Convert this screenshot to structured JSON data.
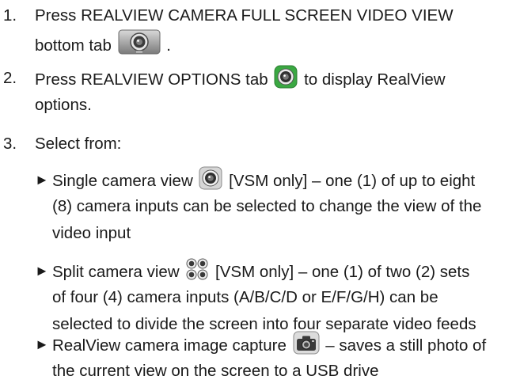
{
  "steps": [
    {
      "number": "1.",
      "line1": "Press REALVIEW CAMERA FULL SCREEN VIDEO VIEW",
      "line2_before": "bottom tab",
      "line2_after": ".",
      "icon": "camera-lens-tab-icon"
    },
    {
      "number": "2.",
      "line1_before": "Press REALVIEW OPTIONS tab",
      "line1_after": "to display RealView",
      "line2": "options.",
      "icon": "green-camera-lens-icon"
    },
    {
      "number": "3.",
      "line1": "Select from:"
    }
  ],
  "options": [
    {
      "bullet": "►",
      "line1_before": "Single camera view",
      "line1_after": "[VSM only] – one (1) of up to eight",
      "line2": "(8) camera inputs can be selected to change the view of the",
      "line3": "video input",
      "icon": "single-camera-lens-icon"
    },
    {
      "bullet": "►",
      "line1_before": "Split camera view",
      "line1_after": "[VSM only] – one (1) of two (2) sets",
      "line2": "of four (4) camera inputs (A/B/C/D or E/F/G/H) can be",
      "line3": "selected to divide the screen into four separate video feeds",
      "icon": "quad-camera-lens-icon"
    },
    {
      "bullet": "►",
      "line1_before": "RealView camera image capture",
      "line1_after": "– saves a still photo of",
      "line2": "the current view on the screen to a USB drive",
      "icon": "photo-camera-icon"
    }
  ]
}
